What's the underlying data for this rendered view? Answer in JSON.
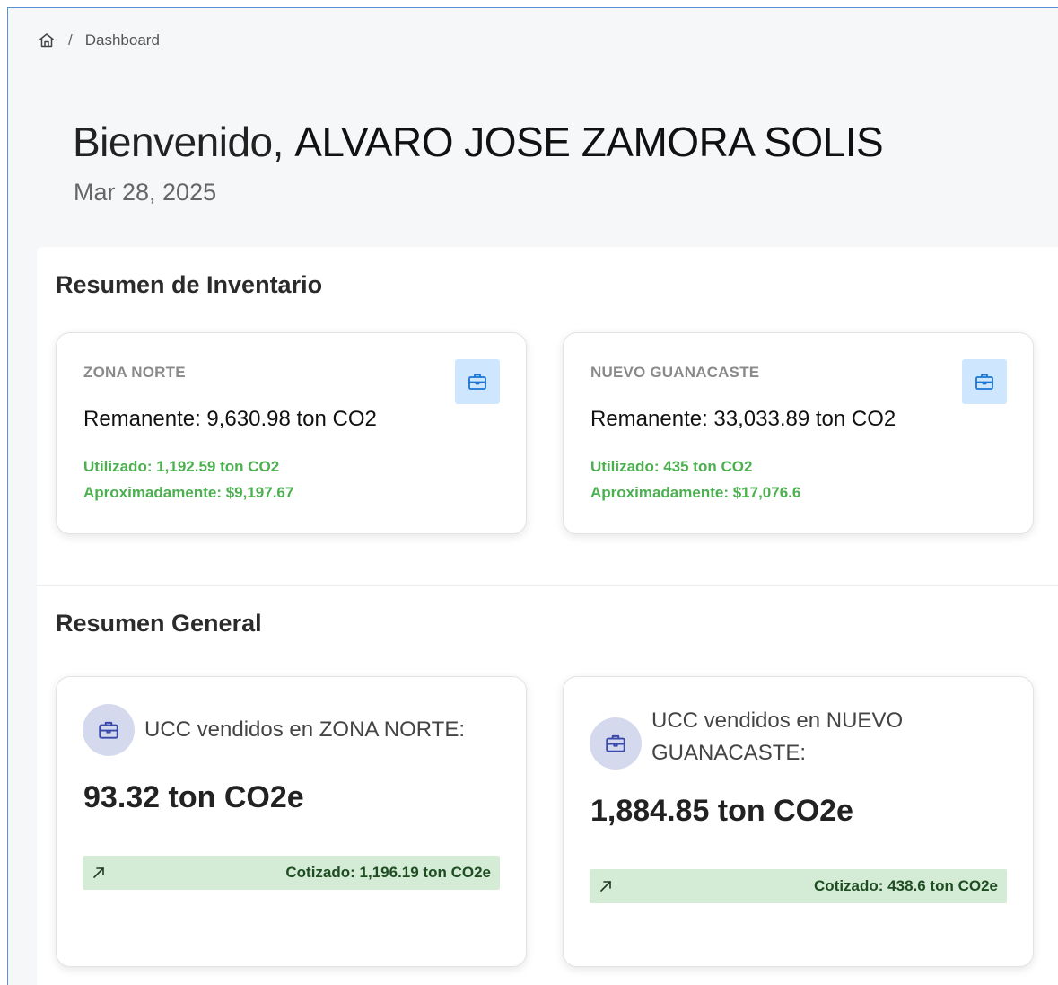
{
  "breadcrumb": {
    "separator": "/",
    "current": "Dashboard"
  },
  "welcome": {
    "greeting": "Bienvenido,",
    "name": "ALVARO JOSE ZAMORA SOLIS",
    "date": "Mar 28, 2025"
  },
  "inventory": {
    "title": "Resumen de Inventario",
    "cards": [
      {
        "zone": "ZONA NORTE",
        "remanente": "Remanente: 9,630.98 ton CO2",
        "utilizado": "Utilizado: 1,192.59 ton CO2",
        "aproximadamente": "Aproximadamente: $9,197.67"
      },
      {
        "zone": "NUEVO GUANACASTE",
        "remanente": "Remanente: 33,033.89 ton CO2",
        "utilizado": "Utilizado: 435 ton CO2",
        "aproximadamente": "Aproximadamente: $17,076.6"
      }
    ]
  },
  "general": {
    "title": "Resumen General",
    "cards": [
      {
        "label": "UCC vendidos en ZONA NORTE:",
        "amount": "93.32 ton CO2e",
        "cotizado": "Cotizado: 1,196.19 ton CO2e"
      },
      {
        "label": "UCC vendidos en NUEVO GUANACASTE:",
        "amount": "1,884.85 ton CO2e",
        "cotizado": "Cotizado: 438.6 ton CO2e"
      }
    ]
  },
  "colors": {
    "accent_green": "#4caf50",
    "badge_blue": "#cfe6ff",
    "icon_blue": "#1976d2",
    "cotizado_bg": "#d4ebd6",
    "circle_bg": "#d5d9ee",
    "icon_indigo": "#3949ab"
  },
  "icons": {
    "home": "home-icon",
    "briefcase": "briefcase-icon",
    "arrow": "arrow-up-right-icon"
  }
}
